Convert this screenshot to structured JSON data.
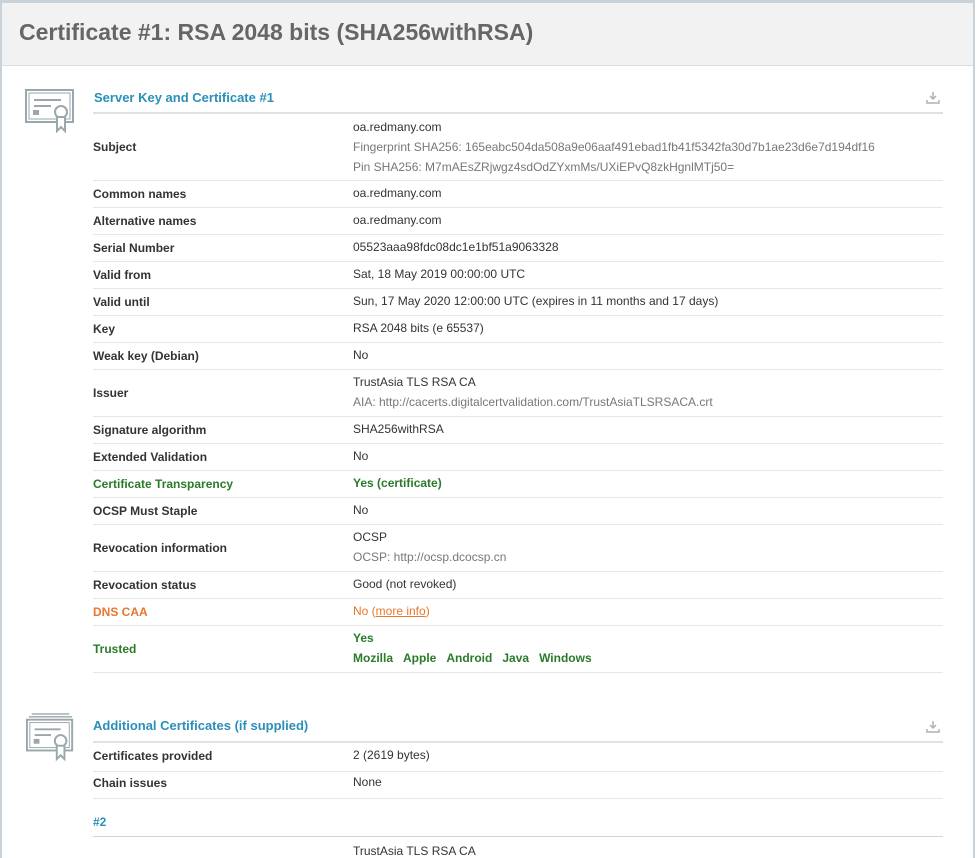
{
  "page": {
    "title": "Certificate #1: RSA 2048 bits (SHA256withRSA)"
  },
  "section1": {
    "title": "Server Key and Certificate #1",
    "rows": {
      "subject": {
        "label": "Subject",
        "value": "oa.redmany.com",
        "fingerprint": "Fingerprint SHA256: 165eabc504da508a9e06aaf491ebad1fb41f5342fa30d7b1ae23d6e7d194df16",
        "pin": "Pin SHA256: M7mAEsZRjwgz4sdOdZYxmMs/UXiEPvQ8zkHgnlMTj50="
      },
      "common_names": {
        "label": "Common names",
        "value": "oa.redmany.com"
      },
      "alternative_names": {
        "label": "Alternative names",
        "value": "oa.redmany.com"
      },
      "serial_number": {
        "label": "Serial Number",
        "value": "05523aaa98fdc08dc1e1bf51a9063328"
      },
      "valid_from": {
        "label": "Valid from",
        "value": "Sat, 18 May 2019 00:00:00 UTC"
      },
      "valid_until": {
        "label": "Valid until",
        "value": "Sun, 17 May 2020 12:00:00 UTC (expires in 11 months and 17 days)"
      },
      "key": {
        "label": "Key",
        "value": "RSA 2048 bits (e 65537)"
      },
      "weak_key": {
        "label": "Weak key (Debian)",
        "value": "No"
      },
      "issuer": {
        "label": "Issuer",
        "value": "TrustAsia TLS RSA CA",
        "aia": "AIA: http://cacerts.digitalcertvalidation.com/TrustAsiaTLSRSACA.crt"
      },
      "signature_algorithm": {
        "label": "Signature algorithm",
        "value": "SHA256withRSA"
      },
      "extended_validation": {
        "label": "Extended Validation",
        "value": "No"
      },
      "certificate_transparency": {
        "label": "Certificate Transparency",
        "value": "Yes (certificate)"
      },
      "ocsp_must_staple": {
        "label": "OCSP Must Staple",
        "value": "No"
      },
      "revocation_information": {
        "label": "Revocation information",
        "value": "OCSP",
        "ocsp": "OCSP: http://ocsp.dcocsp.cn"
      },
      "revocation_status": {
        "label": "Revocation status",
        "value": "Good (not revoked)"
      },
      "dns_caa": {
        "label": "DNS CAA",
        "value_prefix": "No (",
        "link": "more info",
        "value_suffix": ")"
      },
      "trusted": {
        "label": "Trusted",
        "value": "Yes",
        "stores": [
          "Mozilla",
          "Apple",
          "Android",
          "Java",
          "Windows"
        ]
      }
    }
  },
  "section2": {
    "title": "Additional Certificates (if supplied)",
    "rows": {
      "certificates_provided": {
        "label": "Certificates provided",
        "value": "2 (2619 bytes)"
      },
      "chain_issues": {
        "label": "Chain issues",
        "value": "None"
      }
    },
    "cert2": {
      "number": "#2",
      "first_value": "TrustAsia TLS RSA CA"
    }
  },
  "colors": {
    "title_blue": "#2a8fb9",
    "green": "#2a7a2a",
    "orange": "#e8762c",
    "header_bg": "#f2f2f2"
  },
  "icons": [
    "certificate-icon",
    "download-icon"
  ]
}
